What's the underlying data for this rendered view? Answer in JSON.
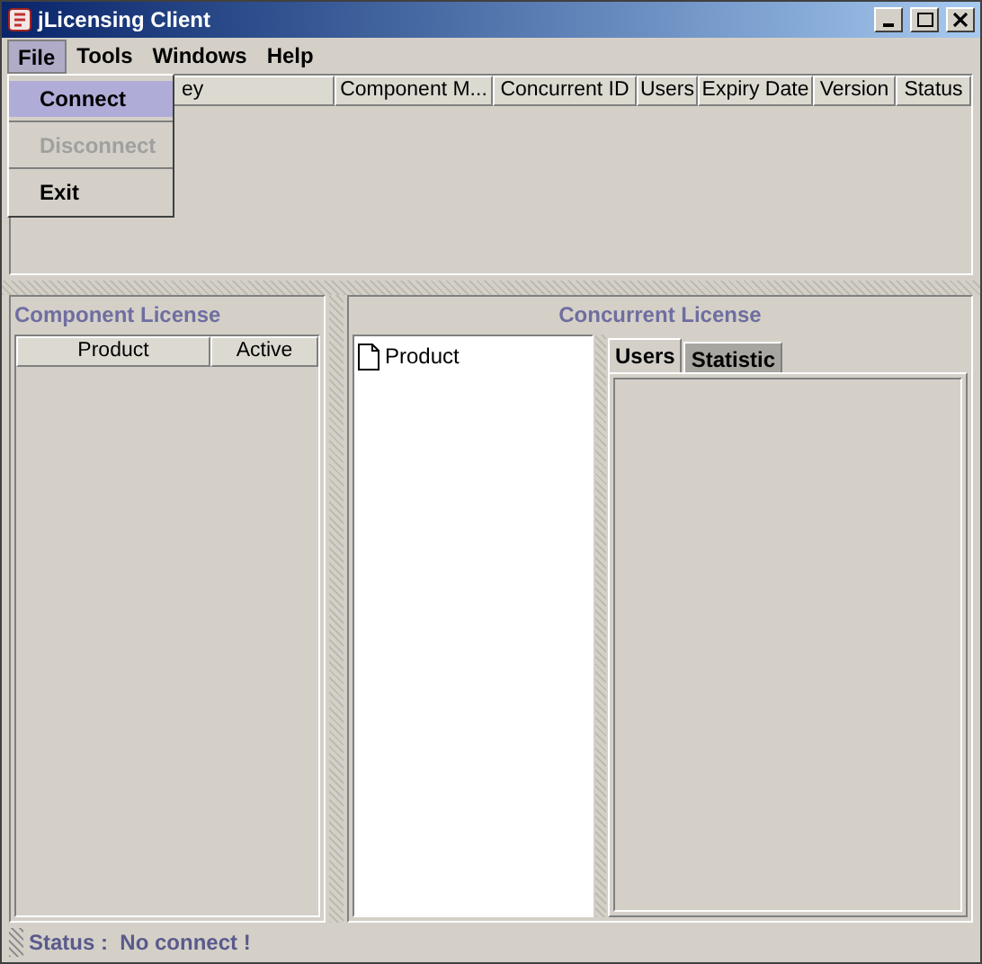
{
  "window": {
    "title": "jLicensing Client"
  },
  "menu_bar": [
    {
      "label": "File",
      "selected": true
    },
    {
      "label": "Tools",
      "selected": false
    },
    {
      "label": "Windows",
      "selected": false
    },
    {
      "label": "Help",
      "selected": false
    }
  ],
  "file_menu": [
    {
      "label": "Connect",
      "selected": true,
      "disabled": false
    },
    {
      "label": "Disconnect",
      "selected": false,
      "disabled": true
    },
    {
      "label": "Exit",
      "selected": false,
      "disabled": false
    }
  ],
  "license_table": {
    "columns": [
      "ey",
      "Component M...",
      "Concurrent ID",
      "Users",
      "Expiry Date",
      "Version",
      "Status"
    ]
  },
  "component_license": {
    "title": "Component License",
    "columns": [
      "Product",
      "Active"
    ]
  },
  "concurrent_license": {
    "title": "Concurrent License",
    "tree": [
      {
        "label": "Product"
      }
    ],
    "tabs": [
      {
        "label": "Users",
        "selected": true
      },
      {
        "label": "Statistic",
        "selected": false
      }
    ]
  },
  "status_bar": {
    "text": "Status :  No connect !"
  }
}
